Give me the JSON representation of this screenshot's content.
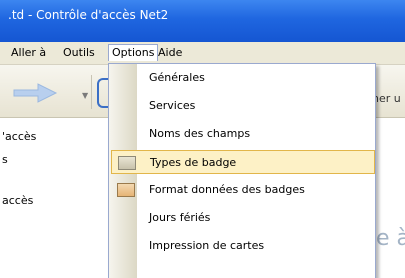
{
  "window": {
    "title": ".td - Contrôle d'accès Net2"
  },
  "menubar": {
    "items": [
      "Aller à",
      "Outils",
      "Options",
      "Aide"
    ],
    "active": "Options"
  },
  "toolbar": {
    "right_text": "her u"
  },
  "tree": {
    "items": [
      "'accès",
      "s",
      "accès"
    ]
  },
  "watermark": {
    "text": "e à"
  },
  "options_menu": {
    "items": [
      {
        "label": "Générales",
        "icon": null
      },
      {
        "label": "Services",
        "icon": null
      },
      {
        "label": "Noms des champs",
        "icon": null
      },
      {
        "label": "Types de badge",
        "icon": "badge-icon",
        "highlighted": true
      },
      {
        "label": "Format données des badges",
        "icon": "badge-format-icon"
      },
      {
        "label": "Jours fériés",
        "icon": null
      },
      {
        "label": "Impression de cartes",
        "icon": null
      }
    ]
  },
  "colors": {
    "titlebar": "#1f66e0",
    "menubar": "#ece9d8",
    "highlight_bg": "#fdf1c6",
    "highlight_border": "#e2b64a",
    "menu_border": "#9aa9cf"
  }
}
